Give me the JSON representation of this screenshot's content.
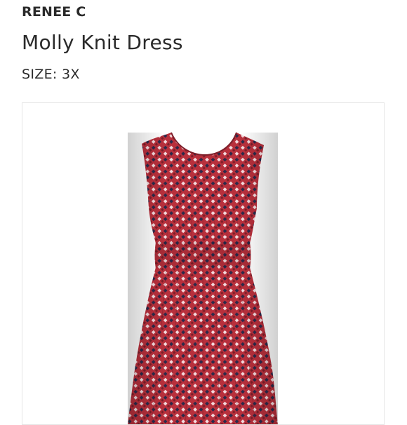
{
  "listing": {
    "brand": "RENEE C",
    "title": "Molly Knit Dress",
    "size_label": "SIZE:",
    "size_value": "3X"
  },
  "image": {
    "subject": "dress-photo",
    "colors": {
      "base": "#b8303c",
      "dark": "#7e1f2a",
      "light": "#f2d9dc",
      "navy": "#2c2a4a"
    }
  }
}
